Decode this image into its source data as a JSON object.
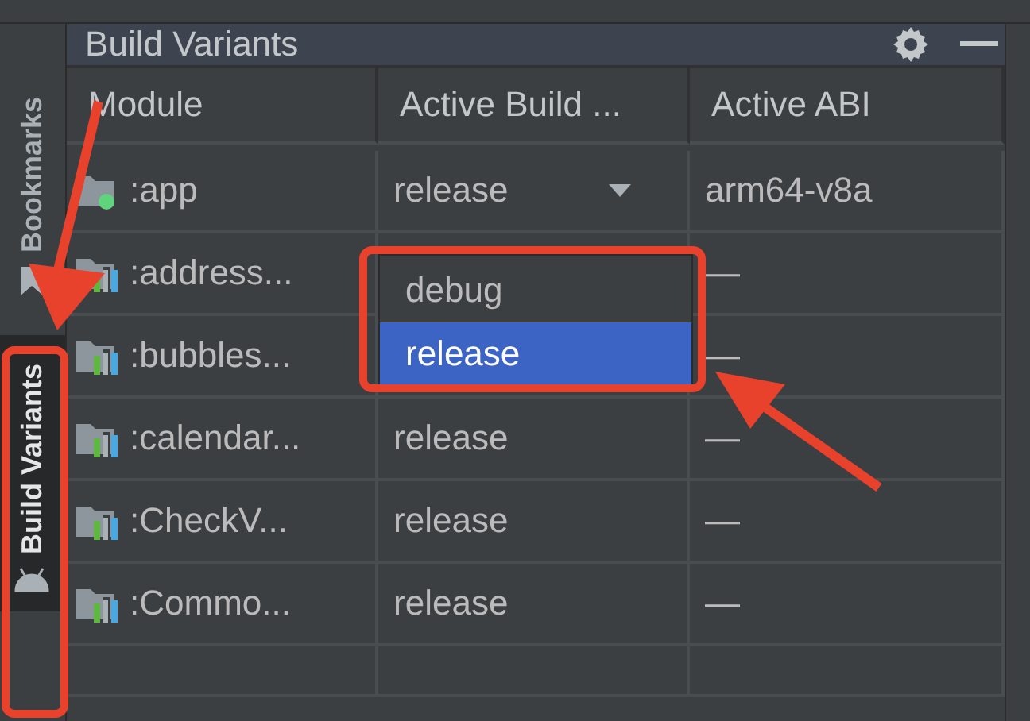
{
  "side_tabs": [
    {
      "label": "Bookmarks",
      "kind": "bookmarks",
      "selected": false
    },
    {
      "label": "Build Variants",
      "kind": "android",
      "selected": true
    }
  ],
  "panel": {
    "title": "Build Variants"
  },
  "table": {
    "columns": [
      "Module",
      "Active Build ...",
      "Active ABI"
    ],
    "rows": [
      {
        "module": ":app",
        "kind": "app",
        "variant": "release",
        "abi": "arm64-v8a"
      },
      {
        "module": ":address...",
        "kind": "library",
        "abi": "—"
      },
      {
        "module": ":bubbles...",
        "kind": "library",
        "abi": "—"
      },
      {
        "module": ":calendar...",
        "kind": "library",
        "variant": "release",
        "abi": "—"
      },
      {
        "module": ":CheckV...",
        "kind": "library",
        "variant": "release",
        "abi": "—"
      },
      {
        "module": ":Commo...",
        "kind": "library",
        "variant": "release",
        "abi": "—"
      }
    ]
  },
  "popup": {
    "options": [
      {
        "label": "debug",
        "selected": false
      },
      {
        "label": "release",
        "selected": true
      }
    ]
  }
}
